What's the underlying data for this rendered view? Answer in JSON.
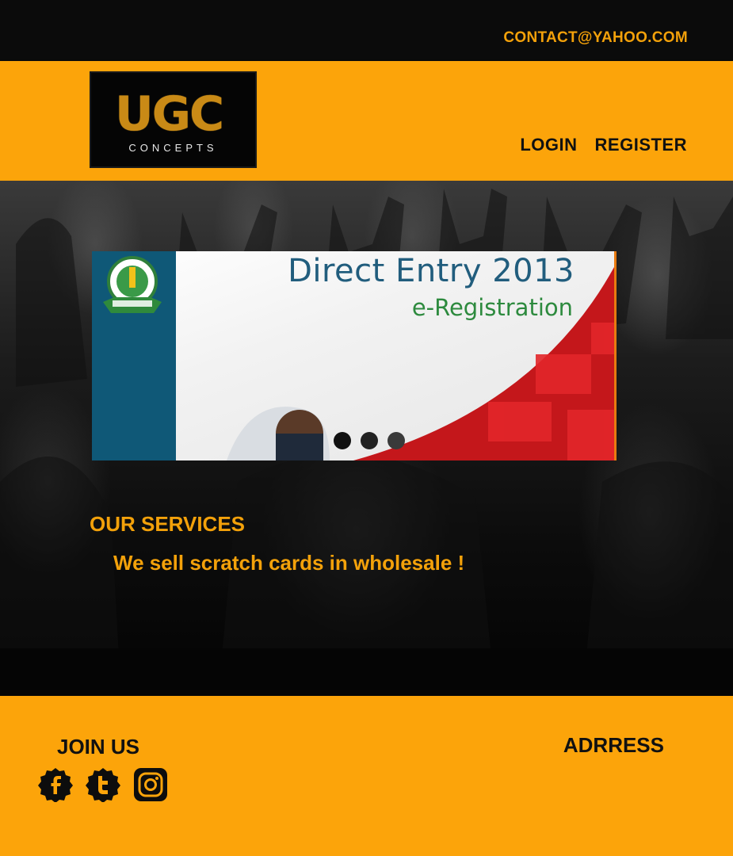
{
  "topbar": {
    "contact": "CONTACT@YAHOO.COM"
  },
  "header": {
    "logo": {
      "mark": "UGC",
      "sub": "CONCEPTS"
    },
    "nav": [
      {
        "label": "LOGIN"
      },
      {
        "label": "REGISTER"
      }
    ]
  },
  "slider": {
    "title": "Direct Entry 2013",
    "subtitle": "e-Registration",
    "badge_icon": "jamb-seal-icon",
    "active_index": 0,
    "dot_count": 3
  },
  "services": {
    "title": "OUR SERVICES",
    "text": "We sell scratch cards in wholesale !"
  },
  "footer": {
    "join_label": "JOIN US",
    "address_label": "ADRRESS",
    "socials": [
      "facebook-icon",
      "twitter-icon",
      "instagram-icon"
    ]
  },
  "colors": {
    "accent": "#fca40a",
    "text_orange": "#f3a10a",
    "dark": "#0b0b0b"
  }
}
